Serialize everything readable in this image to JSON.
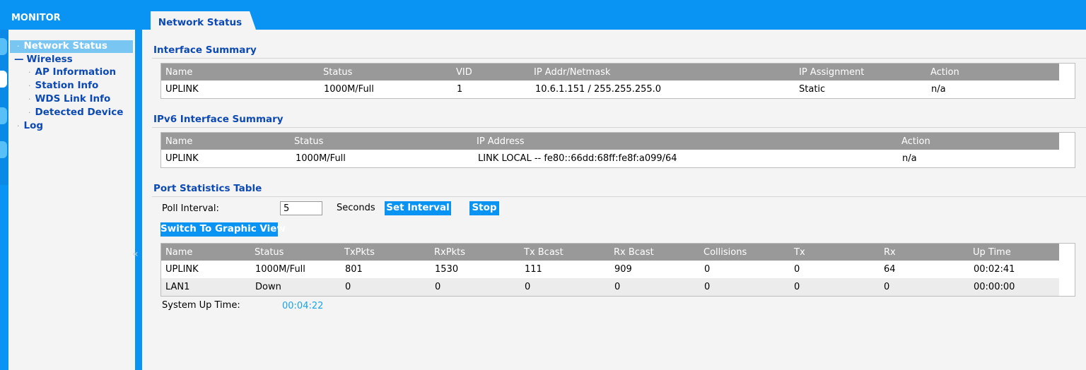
{
  "sidebar": {
    "title": "MONITOR",
    "items": [
      {
        "label": "Network Status"
      },
      {
        "label": "Wireless"
      },
      {
        "label": "AP Information"
      },
      {
        "label": "Station Info"
      },
      {
        "label": "WDS Link Info"
      },
      {
        "label": "Detected Device"
      },
      {
        "label": "Log"
      }
    ]
  },
  "tab": {
    "label": "Network Status"
  },
  "interface_summary": {
    "title": "Interface Summary",
    "columns": [
      "Name",
      "Status",
      "VID",
      "IP Addr/Netmask",
      "IP Assignment",
      "Action"
    ],
    "rows": [
      [
        "UPLINK",
        "1000M/Full",
        "1",
        "10.6.1.151 / 255.255.255.0",
        "Static",
        "n/a"
      ]
    ]
  },
  "ipv6_summary": {
    "title": "IPv6 Interface Summary",
    "columns": [
      "Name",
      "Status",
      "IP Address",
      "Action"
    ],
    "rows": [
      [
        "UPLINK",
        "1000M/Full",
        "LINK LOCAL -- fe80::66dd:68ff:fe8f:a099/64",
        "n/a"
      ]
    ]
  },
  "port_stats": {
    "title": "Port Statistics Table",
    "poll_label": "Poll Interval:",
    "poll_value": "5",
    "seconds_label": "Seconds",
    "set_interval_label": "Set Interval",
    "stop_label": "Stop",
    "graphic_view_label": "Switch To Graphic View",
    "columns": [
      "Name",
      "Status",
      "TxPkts",
      "RxPkts",
      "Tx Bcast",
      "Rx Bcast",
      "Collisions",
      "Tx",
      "Rx",
      "Up Time"
    ],
    "rows": [
      [
        "UPLINK",
        "1000M/Full",
        "801",
        "1530",
        "111",
        "909",
        "0",
        "0",
        "64",
        "00:02:41"
      ],
      [
        "LAN1",
        "Down",
        "0",
        "0",
        "0",
        "0",
        "0",
        "0",
        "0",
        "00:00:00"
      ]
    ],
    "uptime_label": "System Up Time:",
    "uptime_value": "00:04:22"
  },
  "colors": {
    "accent": "#0993f2",
    "link": "#0d49b3",
    "header": "#999999",
    "uptime": "#1aa3e8"
  }
}
